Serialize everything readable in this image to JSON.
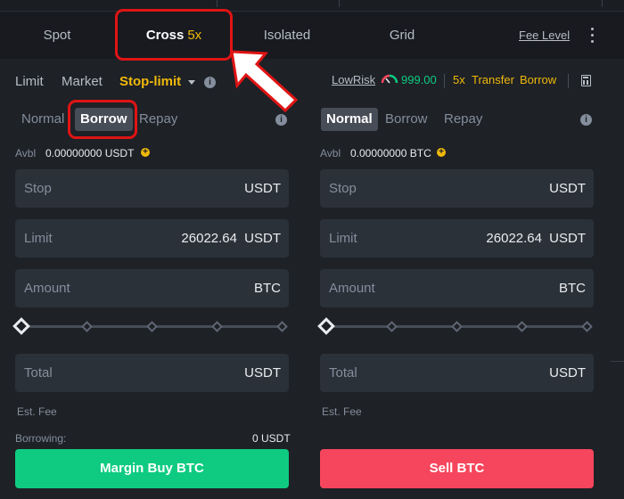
{
  "tabs": [
    {
      "label": "Spot"
    },
    {
      "label": "Cross",
      "leverage": "5x",
      "active": true
    },
    {
      "label": "Isolated"
    },
    {
      "label": "Grid"
    }
  ],
  "fee_level": "Fee Level",
  "order_types": {
    "limit": "Limit",
    "market": "Market",
    "stop_limit": "Stop-limit",
    "active": "stop_limit"
  },
  "risk": {
    "label": "LowRisk",
    "value": "999.00"
  },
  "leverage_link": "5x",
  "transfer": "Transfer",
  "borrow": "Borrow",
  "buy_panel": {
    "modes": [
      "Normal",
      "Borrow",
      "Repay"
    ],
    "active_mode": "Borrow",
    "avbl_label": "Avbl",
    "avbl_value": "0.00000000 USDT",
    "stop": {
      "label": "Stop",
      "unit": "USDT"
    },
    "limit": {
      "label": "Limit",
      "value": "26022.64",
      "unit": "USDT"
    },
    "amount": {
      "label": "Amount",
      "unit": "BTC"
    },
    "slider_percent": 0,
    "total": {
      "label": "Total",
      "unit": "USDT"
    },
    "est_fee": "Est. Fee",
    "borrowing_label": "Borrowing:",
    "borrowing_value": "0 USDT",
    "button": "Margin Buy BTC"
  },
  "sell_panel": {
    "modes": [
      "Normal",
      "Borrow",
      "Repay"
    ],
    "active_mode": "Normal",
    "avbl_label": "Avbl",
    "avbl_value": "0.00000000 BTC",
    "stop": {
      "label": "Stop",
      "unit": "USDT"
    },
    "limit": {
      "label": "Limit",
      "value": "26022.64",
      "unit": "USDT"
    },
    "amount": {
      "label": "Amount",
      "unit": "BTC"
    },
    "slider_percent": 0,
    "total": {
      "label": "Total",
      "unit": "USDT"
    },
    "est_fee": "Est. Fee",
    "button": "Sell BTC"
  },
  "colors": {
    "accent": "#f0b90b",
    "buy": "#0ecb81",
    "sell": "#f6465d",
    "annotation": "#e01414"
  },
  "icons": [
    "info-icon",
    "plus-circle-icon",
    "gauge-icon",
    "calculator-icon",
    "kebab-menu-icon",
    "caret-down-icon"
  ]
}
